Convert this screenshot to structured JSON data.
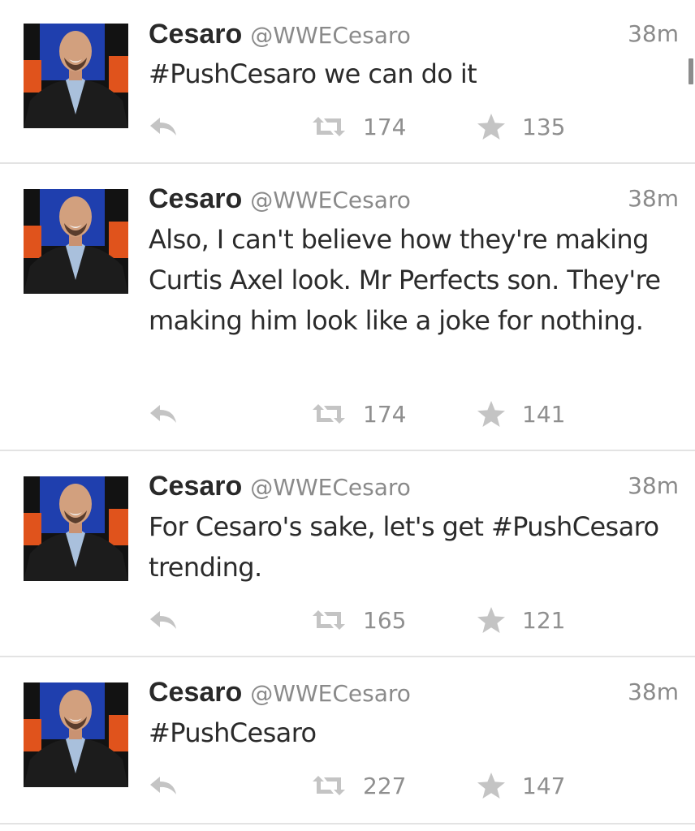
{
  "tweets": [
    {
      "name": "Cesaro",
      "handle": "@WWECesaro",
      "time": "38m",
      "text": "#PushCesaro we can do it",
      "retweets": "174",
      "favorites": "135",
      "avatar_icon": "profile-photo"
    },
    {
      "name": "Cesaro",
      "handle": "@WWECesaro",
      "time": "38m",
      "text": "Also, I can't believe how they're making Curtis Axel look. Mr Perfects son. They're making him look like a joke for nothing.",
      "retweets": "174",
      "favorites": "141",
      "avatar_icon": "profile-photo"
    },
    {
      "name": "Cesaro",
      "handle": "@WWECesaro",
      "time": "38m",
      "text": "For Cesaro's sake, let's get #PushCesaro trending.",
      "retweets": "165",
      "favorites": "121",
      "avatar_icon": "profile-photo"
    },
    {
      "name": "Cesaro",
      "handle": "@WWECesaro",
      "time": "38m",
      "text": "#PushCesaro",
      "retweets": "227",
      "favorites": "147",
      "avatar_icon": "profile-photo"
    }
  ],
  "icons": {
    "reply": "reply-icon",
    "retweet": "retweet-icon",
    "favorite": "star-icon"
  },
  "colors": {
    "icon_gray": "#c4c4c4",
    "divider": "#e3e3e3"
  }
}
